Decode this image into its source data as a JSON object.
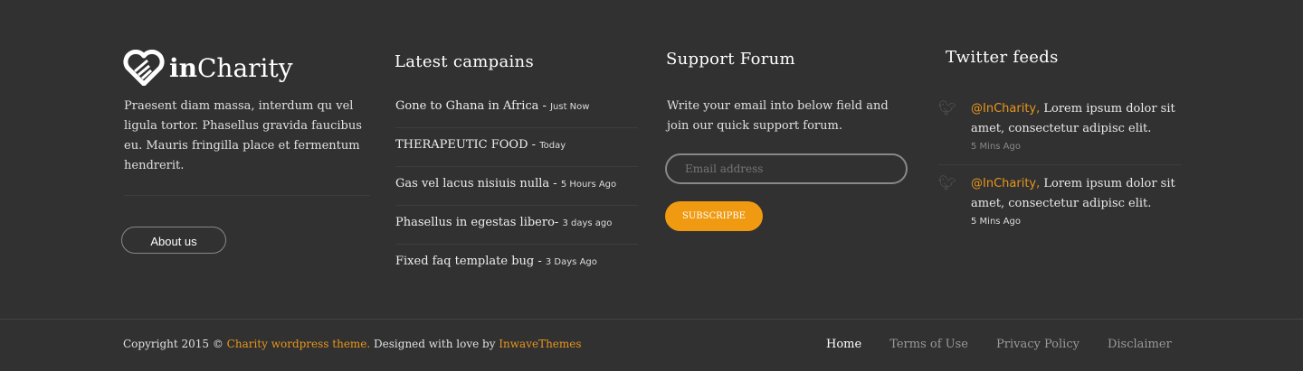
{
  "logo": {
    "bold": "in",
    "rest": "Charity"
  },
  "about": {
    "text": "Praesent diam massa, interdum qu vel ligula tortor. Phasellus gravida faucibus eu. Mauris fringilla place et fermentum hendrerit.",
    "button": "About us"
  },
  "campaigns": {
    "title": "Latest campains",
    "items": [
      {
        "title": "Gone to Ghana in Africa",
        "time": "Just Now"
      },
      {
        "title": "THERAPEUTIC FOOD",
        "time": "Today"
      },
      {
        "title": "Gas vel lacus nisiuis nulla ",
        "time": "5 Hours Ago"
      },
      {
        "title": "Phasellus in egestas libero",
        "time": "3 days ago"
      },
      {
        "title": "Fixed faq template bug",
        "time": "3 Days Ago"
      }
    ]
  },
  "forum": {
    "title": "Support Forum",
    "text": "Write your email into below field and join our quick support forum.",
    "placeholder": "Email address",
    "button": "SUBSCRIPBE"
  },
  "twitter": {
    "title": "Twitter feeds",
    "items": [
      {
        "handle": "@InCharity,",
        "text": " Lorem ipsum dolor sit amet, consectetur adipisc elit.",
        "time": "5 Mins Ago"
      },
      {
        "handle": "@InCharity,",
        "text": " Lorem ipsum dolor sit amet, consectetur adipisc elit.",
        "time": "5 Mins Ago"
      }
    ]
  },
  "footer": {
    "copy1": "Copyright 2015 © ",
    "link1": "Charity wordpress theme.",
    "copy2": " Designed  with love by ",
    "link2": "InwaveThemes",
    "nav": [
      "Home",
      "Terms of Use",
      "Privacy Policy",
      "Disclaimer"
    ]
  }
}
